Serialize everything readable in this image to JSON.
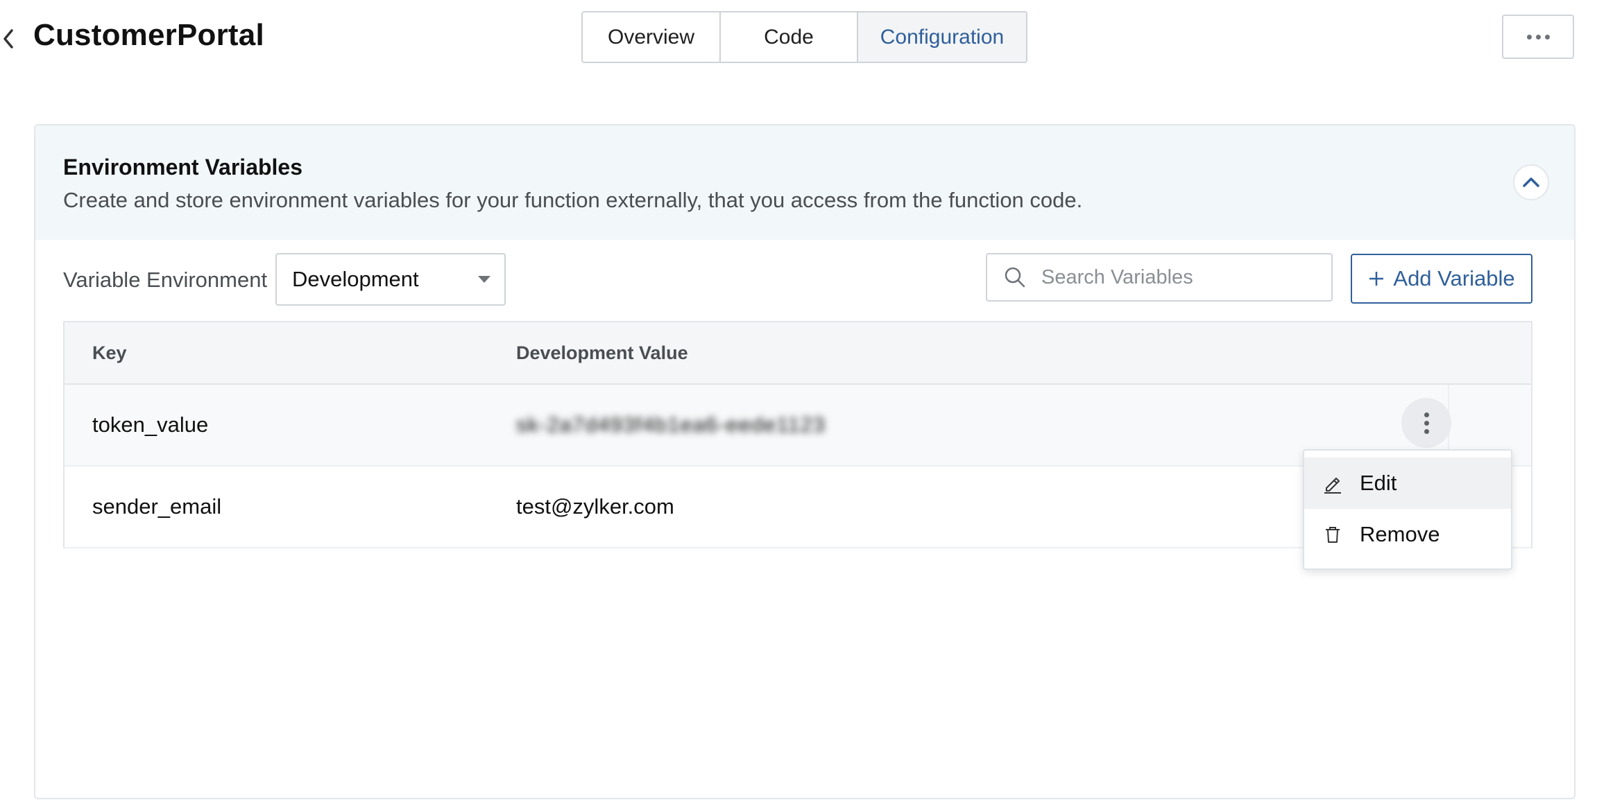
{
  "header": {
    "title": "CustomerPortal",
    "tabs": [
      {
        "label": "Overview"
      },
      {
        "label": "Code"
      },
      {
        "label": "Configuration"
      }
    ],
    "active_tab": "Configuration"
  },
  "panel": {
    "title": "Environment Variables",
    "description": "Create and store environment variables for your function externally, that you access from the function code."
  },
  "toolbar": {
    "env_label": "Variable Environment",
    "env_selected": "Development",
    "search_placeholder": "Search Variables",
    "add_label": "Add Variable"
  },
  "table": {
    "columns": [
      "Key",
      "Development Value"
    ],
    "rows": [
      {
        "key": "token_value",
        "value": "sk-2a7d493f4b1ea6-eede1123"
      },
      {
        "key": "sender_email",
        "value": "test@zylker.com"
      }
    ]
  },
  "menu": {
    "items": [
      {
        "label": "Edit",
        "icon": "pencil-icon"
      },
      {
        "label": "Remove",
        "icon": "trash-icon"
      }
    ]
  },
  "colors": {
    "accent": "#2f5f9a",
    "header_bg": "#f2f7fa",
    "active_tab_bg": "#f2f4f6"
  }
}
